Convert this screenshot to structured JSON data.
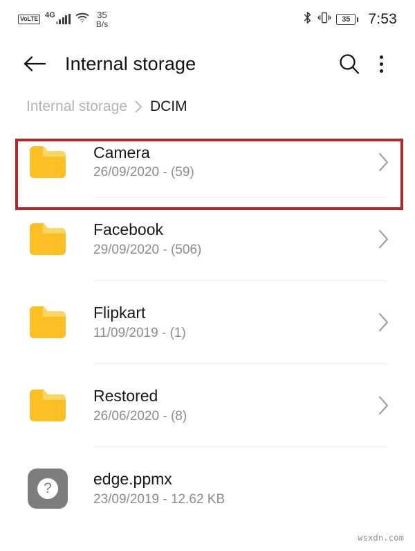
{
  "status_bar": {
    "volte_label": "VoLTE",
    "network_type": "4G",
    "signal_icon": "signal-bars-icon",
    "wifi_icon": "wifi-icon",
    "data_rate_value": "35",
    "data_rate_unit": "B/s",
    "bluetooth_icon": "bluetooth-icon",
    "vibrate_icon": "vibrate-icon",
    "battery_level": "35",
    "time": "7:53"
  },
  "app_bar": {
    "back_icon": "arrow-left-icon",
    "title": "Internal storage",
    "search_icon": "search-icon",
    "overflow_icon": "more-vertical-icon"
  },
  "breadcrumb": {
    "root": "Internal storage",
    "separator_icon": "chevron-right-icon",
    "current": "DCIM"
  },
  "colors": {
    "folder_yellow": "#fbbf24",
    "folder_tab_light": "#fcd661",
    "highlight_red": "#b4262a",
    "unknown_icon_gray": "#7d7d7d",
    "meta_text_gray": "#8c8c8c",
    "divider_gray": "#e6e6e6"
  },
  "file_list": [
    {
      "name": "Camera",
      "meta": "26/09/2020 - (59)",
      "icon": "folder-icon",
      "chevron_icon": "chevron-right-icon",
      "highlighted": true
    },
    {
      "name": "Facebook",
      "meta": "29/09/2020 - (506)",
      "icon": "folder-icon",
      "chevron_icon": "chevron-right-icon",
      "highlighted": false
    },
    {
      "name": "Flipkart",
      "meta": "11/09/2019 - (1)",
      "icon": "folder-icon",
      "chevron_icon": "chevron-right-icon",
      "highlighted": false
    },
    {
      "name": "Restored",
      "meta": "26/06/2020 - (8)",
      "icon": "folder-icon",
      "chevron_icon": "chevron-right-icon",
      "highlighted": false
    },
    {
      "name": "edge.ppmx",
      "meta": "23/09/2019 - 12.62 KB",
      "icon": "unknown-file-icon",
      "chevron_icon": "",
      "highlighted": false
    }
  ],
  "watermark": "wsxdn.com"
}
